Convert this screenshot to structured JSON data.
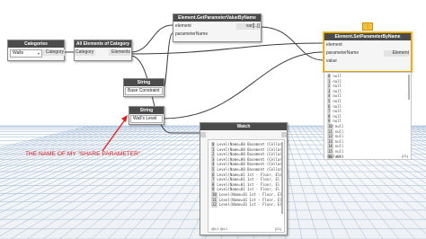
{
  "nodes": {
    "categories": {
      "title": "Categories",
      "dropdown_value": "Walls",
      "output_port": "Category"
    },
    "all_elements": {
      "title": "All Elements of Category",
      "input_port": "Category",
      "output_port": "Elements"
    },
    "get_param": {
      "title": "Element.GetParameterValueByName",
      "input_ports": [
        "element",
        "parameterName"
      ],
      "output_port": "var[]..[]"
    },
    "string_base": {
      "title": "String",
      "value": "Base Constraint"
    },
    "string_walls": {
      "title": "String",
      "value": "Wall's Level"
    },
    "set_param": {
      "title": "Element.SetParameterByName",
      "input_ports": [
        "element",
        "parameterName",
        "value"
      ],
      "output_port": "Element",
      "warning_badge": "!",
      "list_rows": [
        [
          "0",
          "null"
        ],
        [
          "1",
          "null"
        ],
        [
          "2",
          "null"
        ],
        [
          "3",
          "null"
        ],
        [
          "4",
          "null"
        ],
        [
          "5",
          "null"
        ],
        [
          "6",
          "null"
        ],
        [
          "7",
          "null"
        ],
        [
          "8",
          "null"
        ],
        [
          "9",
          "null"
        ],
        [
          "10",
          "null"
        ],
        [
          "11",
          "null"
        ],
        [
          "12",
          "null"
        ],
        [
          "13",
          "null"
        ],
        [
          "14",
          "null"
        ],
        [
          "15",
          "null"
        ],
        [
          "16",
          "null"
        ],
        [
          "17",
          "null"
        ],
        [
          "18",
          "null"
        ]
      ],
      "list_footer_left": "@L2 @L1",
      "list_footer_right": "{21}"
    },
    "watch": {
      "title": "Watch",
      "list_rows": [
        [
          "0",
          "Level(Name=00 Basement (Cellar"
        ],
        [
          "1",
          "Level(Name=00 Basement (Cellar"
        ],
        [
          "2",
          "Level(Name=00 Basement (Cellar"
        ],
        [
          "3",
          "Level(Name=00 Basement (Cellar"
        ],
        [
          "4",
          "Level(Name=00 Basement (Cellar"
        ],
        [
          "5",
          "Level(Name=00 Basement (Cellar"
        ],
        [
          "6",
          "Level(Name=01 1st - Floor, Ele"
        ],
        [
          "7",
          "Level(Name=01 1st - Floor, El"
        ],
        [
          "8",
          "Level(Name=01 1st - Floor, El"
        ],
        [
          "9",
          "Level(Name=01 1st - Floor, El"
        ],
        [
          "10",
          "Level(Name=01 1st - Floor, El"
        ],
        [
          "11",
          "Level(Name=01 1st - Floor, El"
        ],
        [
          "12",
          "Level(Name=01 1st - Floor, El"
        ]
      ],
      "list_footer_left": "@L2 @L1",
      "list_footer_right": "{21}"
    }
  },
  "annotation": {
    "text": "THE NAME OF MY \"SHARE PARAMETER\""
  },
  "colors": {
    "node_header": "#4b4b4b",
    "wire": "#3a3a3a",
    "selection": "#f2c23a",
    "annotation": "#e01e1e",
    "grid": "#9eb7d4"
  }
}
